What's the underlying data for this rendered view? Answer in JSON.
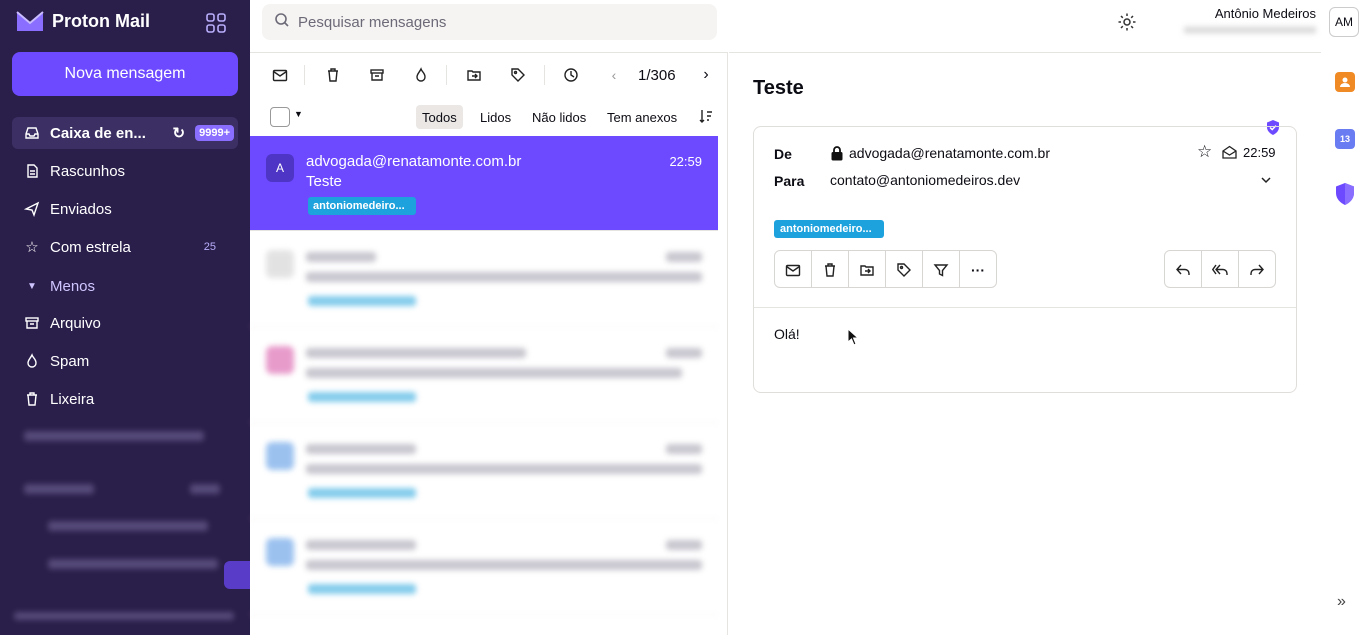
{
  "brand": {
    "name": "Proton Mail"
  },
  "sidebar": {
    "new_message": "Nova mensagem",
    "items": [
      {
        "label": "Caixa de en...",
        "badge": "9999+"
      },
      {
        "label": "Rascunhos"
      },
      {
        "label": "Enviados"
      },
      {
        "label": "Com estrela",
        "count": "25"
      },
      {
        "label": "Menos"
      },
      {
        "label": "Arquivo"
      },
      {
        "label": "Spam"
      },
      {
        "label": "Lixeira"
      }
    ]
  },
  "search": {
    "placeholder": "Pesquisar mensagens"
  },
  "user": {
    "name": "Antônio Medeiros",
    "initials": "AM"
  },
  "list": {
    "pager": "1/306",
    "filters": [
      "Todos",
      "Lidos",
      "Não lidos",
      "Tem anexos"
    ],
    "selected": {
      "initial": "A",
      "from": "advogada@renatamonte.com.br",
      "subject": "Teste",
      "time": "22:59",
      "tag": "antoniomedeiro..."
    }
  },
  "message": {
    "subject": "Teste",
    "from_label": "De",
    "from": "advogada@renatamonte.com.br",
    "to_label": "Para",
    "to": "contato@antoniomedeiros.dev",
    "time": "22:59",
    "tag": "antoniomedeiro...",
    "body": "Olá!"
  },
  "colors": {
    "sidebar": "#2a1e4a",
    "accent": "#6d4aff",
    "tag": "#1ea2dd"
  }
}
